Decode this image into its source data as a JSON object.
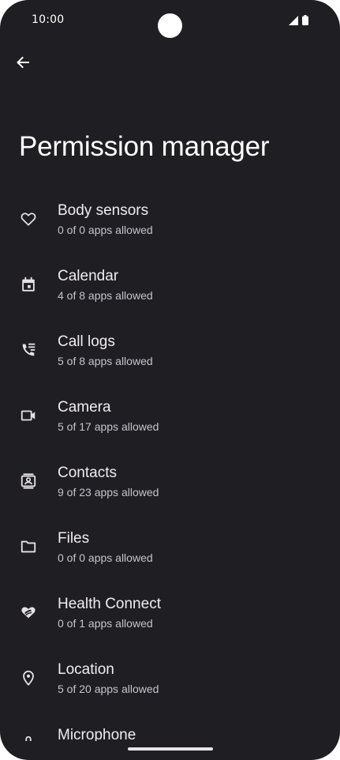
{
  "status_bar": {
    "time": "10:00",
    "icons": [
      "signal-icon",
      "battery-icon"
    ]
  },
  "header": {
    "back_icon": "back-arrow-icon",
    "title": "Permission manager"
  },
  "permissions": [
    {
      "label": "Body sensors",
      "summary": "0 of 0 apps allowed",
      "icon": "heart-icon"
    },
    {
      "label": "Calendar",
      "summary": "4 of 8 apps allowed",
      "icon": "calendar-icon"
    },
    {
      "label": "Call logs",
      "summary": "5 of 8 apps allowed",
      "icon": "call-log-icon"
    },
    {
      "label": "Camera",
      "summary": "5 of 17 apps allowed",
      "icon": "video-camera-icon"
    },
    {
      "label": "Contacts",
      "summary": "9 of 23 apps allowed",
      "icon": "contacts-icon"
    },
    {
      "label": "Files",
      "summary": "0 of 0 apps allowed",
      "icon": "folder-icon"
    },
    {
      "label": "Health Connect",
      "summary": "0 of 1 apps allowed",
      "icon": "health-connect-icon"
    },
    {
      "label": "Location",
      "summary": "5 of 20 apps allowed",
      "icon": "location-pin-icon"
    },
    {
      "label": "Microphone",
      "summary": "",
      "icon": "microphone-icon"
    }
  ],
  "colors": {
    "background": "#1f1f23",
    "text_primary": "#f0ecf1",
    "text_secondary": "#c7c2cb"
  }
}
